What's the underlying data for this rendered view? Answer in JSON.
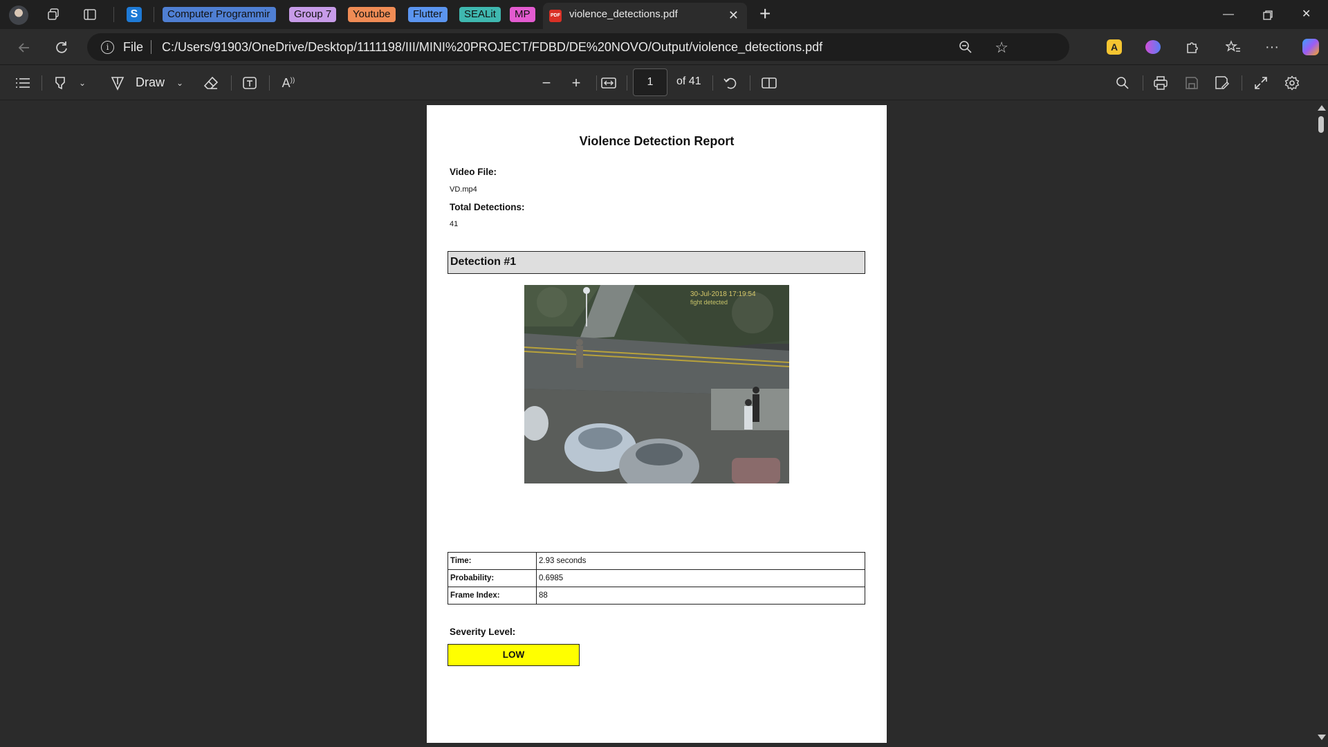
{
  "tabs": {
    "groups": [
      {
        "label": "Computer Programmir",
        "color": "#4f7fd3"
      },
      {
        "label": "Group 7",
        "color": "#c79be8"
      },
      {
        "label": "Youtube",
        "color": "#f08c55"
      },
      {
        "label": "Flutter",
        "color": "#5b95f0"
      },
      {
        "label": "SEALit",
        "color": "#3fb8b0"
      },
      {
        "label": "MP",
        "color": "#e35bd0"
      }
    ],
    "active_tab_title": "violence_detections.pdf",
    "pdf_icon_text": "PDF"
  },
  "address": {
    "scheme_label": "File",
    "url": "C:/Users/91903/OneDrive/Desktop/1111198/III/MINI%20PROJECT/FDBD/DE%20NOVO/Output/violence_detections.pdf"
  },
  "toolbar": {
    "draw_label": "Draw",
    "page_current": "1",
    "page_total_label": "of 41"
  },
  "document": {
    "title": "Violence Detection Report",
    "video_file_label": "Video File:",
    "video_file_value": "VD.mp4",
    "total_detections_label": "Total Detections:",
    "total_detections_value": "41",
    "detection_header": "Detection #1",
    "frame_overlay_timestamp": "30-Jul-2018 17:19:54",
    "frame_overlay_status": "fight detected",
    "details": [
      {
        "key": "Time:",
        "value": "2.93 seconds"
      },
      {
        "key": "Probability:",
        "value": "0.6985"
      },
      {
        "key": "Frame Index:",
        "value": "88"
      }
    ],
    "severity_label": "Severity Level:",
    "severity_value": "LOW",
    "severity_color": "#ffff00"
  }
}
